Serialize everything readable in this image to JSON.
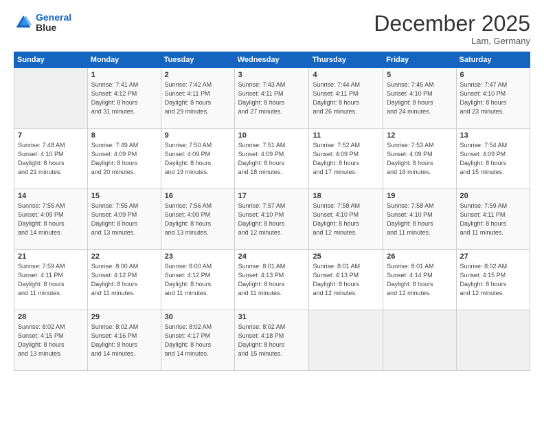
{
  "header": {
    "logo_line1": "General",
    "logo_line2": "Blue",
    "month": "December 2025",
    "location": "Lam, Germany"
  },
  "weekdays": [
    "Sunday",
    "Monday",
    "Tuesday",
    "Wednesday",
    "Thursday",
    "Friday",
    "Saturday"
  ],
  "weeks": [
    [
      {
        "day": "",
        "sunrise": "",
        "sunset": "",
        "daylight": ""
      },
      {
        "day": "1",
        "sunrise": "Sunrise: 7:41 AM",
        "sunset": "Sunset: 4:12 PM",
        "daylight": "Daylight: 8 hours and 31 minutes."
      },
      {
        "day": "2",
        "sunrise": "Sunrise: 7:42 AM",
        "sunset": "Sunset: 4:11 PM",
        "daylight": "Daylight: 8 hours and 29 minutes."
      },
      {
        "day": "3",
        "sunrise": "Sunrise: 7:43 AM",
        "sunset": "Sunset: 4:11 PM",
        "daylight": "Daylight: 8 hours and 27 minutes."
      },
      {
        "day": "4",
        "sunrise": "Sunrise: 7:44 AM",
        "sunset": "Sunset: 4:11 PM",
        "daylight": "Daylight: 8 hours and 26 minutes."
      },
      {
        "day": "5",
        "sunrise": "Sunrise: 7:45 AM",
        "sunset": "Sunset: 4:10 PM",
        "daylight": "Daylight: 8 hours and 24 minutes."
      },
      {
        "day": "6",
        "sunrise": "Sunrise: 7:47 AM",
        "sunset": "Sunset: 4:10 PM",
        "daylight": "Daylight: 8 hours and 23 minutes."
      }
    ],
    [
      {
        "day": "7",
        "sunrise": "Sunrise: 7:48 AM",
        "sunset": "Sunset: 4:10 PM",
        "daylight": "Daylight: 8 hours and 21 minutes."
      },
      {
        "day": "8",
        "sunrise": "Sunrise: 7:49 AM",
        "sunset": "Sunset: 4:09 PM",
        "daylight": "Daylight: 8 hours and 20 minutes."
      },
      {
        "day": "9",
        "sunrise": "Sunrise: 7:50 AM",
        "sunset": "Sunset: 4:09 PM",
        "daylight": "Daylight: 8 hours and 19 minutes."
      },
      {
        "day": "10",
        "sunrise": "Sunrise: 7:51 AM",
        "sunset": "Sunset: 4:09 PM",
        "daylight": "Daylight: 8 hours and 18 minutes."
      },
      {
        "day": "11",
        "sunrise": "Sunrise: 7:52 AM",
        "sunset": "Sunset: 4:09 PM",
        "daylight": "Daylight: 8 hours and 17 minutes."
      },
      {
        "day": "12",
        "sunrise": "Sunrise: 7:53 AM",
        "sunset": "Sunset: 4:09 PM",
        "daylight": "Daylight: 8 hours and 16 minutes."
      },
      {
        "day": "13",
        "sunrise": "Sunrise: 7:54 AM",
        "sunset": "Sunset: 4:09 PM",
        "daylight": "Daylight: 8 hours and 15 minutes."
      }
    ],
    [
      {
        "day": "14",
        "sunrise": "Sunrise: 7:55 AM",
        "sunset": "Sunset: 4:09 PM",
        "daylight": "Daylight: 8 hours and 14 minutes."
      },
      {
        "day": "15",
        "sunrise": "Sunrise: 7:55 AM",
        "sunset": "Sunset: 4:09 PM",
        "daylight": "Daylight: 8 hours and 13 minutes."
      },
      {
        "day": "16",
        "sunrise": "Sunrise: 7:56 AM",
        "sunset": "Sunset: 4:09 PM",
        "daylight": "Daylight: 8 hours and 13 minutes."
      },
      {
        "day": "17",
        "sunrise": "Sunrise: 7:57 AM",
        "sunset": "Sunset: 4:10 PM",
        "daylight": "Daylight: 8 hours and 12 minutes."
      },
      {
        "day": "18",
        "sunrise": "Sunrise: 7:58 AM",
        "sunset": "Sunset: 4:10 PM",
        "daylight": "Daylight: 8 hours and 12 minutes."
      },
      {
        "day": "19",
        "sunrise": "Sunrise: 7:58 AM",
        "sunset": "Sunset: 4:10 PM",
        "daylight": "Daylight: 8 hours and 11 minutes."
      },
      {
        "day": "20",
        "sunrise": "Sunrise: 7:59 AM",
        "sunset": "Sunset: 4:11 PM",
        "daylight": "Daylight: 8 hours and 11 minutes."
      }
    ],
    [
      {
        "day": "21",
        "sunrise": "Sunrise: 7:59 AM",
        "sunset": "Sunset: 4:11 PM",
        "daylight": "Daylight: 8 hours and 11 minutes."
      },
      {
        "day": "22",
        "sunrise": "Sunrise: 8:00 AM",
        "sunset": "Sunset: 4:12 PM",
        "daylight": "Daylight: 8 hours and 11 minutes."
      },
      {
        "day": "23",
        "sunrise": "Sunrise: 8:00 AM",
        "sunset": "Sunset: 4:12 PM",
        "daylight": "Daylight: 8 hours and 11 minutes."
      },
      {
        "day": "24",
        "sunrise": "Sunrise: 8:01 AM",
        "sunset": "Sunset: 4:13 PM",
        "daylight": "Daylight: 8 hours and 11 minutes."
      },
      {
        "day": "25",
        "sunrise": "Sunrise: 8:01 AM",
        "sunset": "Sunset: 4:13 PM",
        "daylight": "Daylight: 8 hours and 12 minutes."
      },
      {
        "day": "26",
        "sunrise": "Sunrise: 8:01 AM",
        "sunset": "Sunset: 4:14 PM",
        "daylight": "Daylight: 8 hours and 12 minutes."
      },
      {
        "day": "27",
        "sunrise": "Sunrise: 8:02 AM",
        "sunset": "Sunset: 4:15 PM",
        "daylight": "Daylight: 8 hours and 12 minutes."
      }
    ],
    [
      {
        "day": "28",
        "sunrise": "Sunrise: 8:02 AM",
        "sunset": "Sunset: 4:15 PM",
        "daylight": "Daylight: 8 hours and 13 minutes."
      },
      {
        "day": "29",
        "sunrise": "Sunrise: 8:02 AM",
        "sunset": "Sunset: 4:16 PM",
        "daylight": "Daylight: 8 hours and 14 minutes."
      },
      {
        "day": "30",
        "sunrise": "Sunrise: 8:02 AM",
        "sunset": "Sunset: 4:17 PM",
        "daylight": "Daylight: 8 hours and 14 minutes."
      },
      {
        "day": "31",
        "sunrise": "Sunrise: 8:02 AM",
        "sunset": "Sunset: 4:18 PM",
        "daylight": "Daylight: 8 hours and 15 minutes."
      },
      {
        "day": "",
        "sunrise": "",
        "sunset": "",
        "daylight": ""
      },
      {
        "day": "",
        "sunrise": "",
        "sunset": "",
        "daylight": ""
      },
      {
        "day": "",
        "sunrise": "",
        "sunset": "",
        "daylight": ""
      }
    ]
  ]
}
